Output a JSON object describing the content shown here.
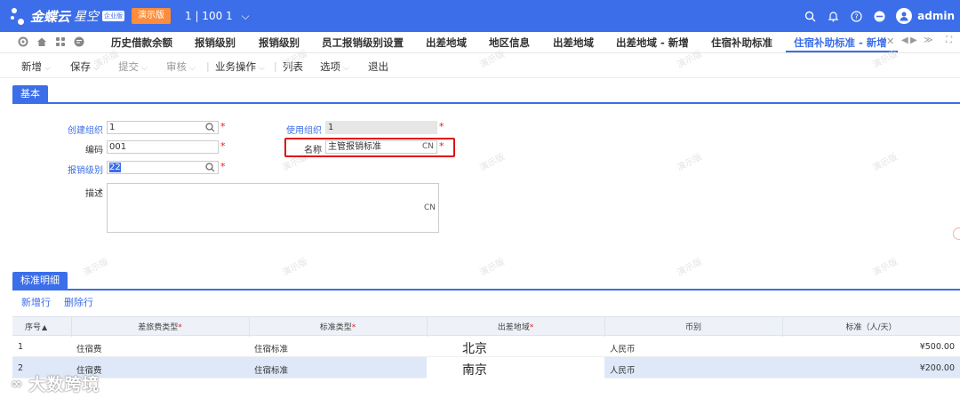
{
  "app": {
    "brand": "金蝶云",
    "brand_sub": "星空",
    "brand_tag": "企业版",
    "demo_badge": "演示版",
    "org_selector": "1 | 100 1",
    "user": "admin"
  },
  "tabs": [
    {
      "label": "历史借款余额"
    },
    {
      "label": "报销级别"
    },
    {
      "label": "报销级别"
    },
    {
      "label": "员工报销级别设置"
    },
    {
      "label": "出差地域"
    },
    {
      "label": "地区信息"
    },
    {
      "label": "出差地域"
    },
    {
      "label": "出差地域 - 新增"
    },
    {
      "label": "住宿补助标准"
    },
    {
      "label": "住宿补助标准 - 新增",
      "active": true
    }
  ],
  "toolbar": {
    "new": "新增",
    "save": "保存",
    "submit": "提交",
    "audit": "审核",
    "business_ops": "业务操作",
    "list": "列表",
    "options": "选项",
    "exit": "退出"
  },
  "watermark": "演示版",
  "sections": {
    "basic": "基本",
    "detail": "标准明细"
  },
  "form": {
    "create_org_label": "创建组织",
    "create_org_value": "1",
    "use_org_label": "使用组织",
    "use_org_value": "1",
    "code_label": "编码",
    "code_value": "001",
    "name_label": "名称",
    "name_value": "主管报销标准",
    "level_label": "报销级别",
    "level_value": "22",
    "desc_label": "描述",
    "cn": "CN",
    "required_mark": "*"
  },
  "grid_actions": {
    "add_row": "新增行",
    "delete_row": "删除行"
  },
  "grid": {
    "columns": [
      "序号",
      "差旅费类型",
      "标准类型",
      "出差地域",
      "币别",
      "标准（人/天）"
    ],
    "rows": [
      [
        "1",
        "住宿费",
        "住宿标准",
        "北京",
        "人民币",
        "¥500.00"
      ],
      [
        "2",
        "住宿费",
        "住宿标准",
        "南京",
        "人民币",
        "¥200.00"
      ]
    ]
  },
  "bottom_watermark": "大数跨境"
}
